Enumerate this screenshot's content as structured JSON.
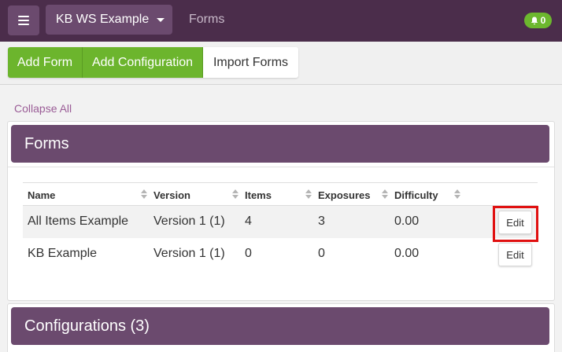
{
  "nav": {
    "workspace_label": "KB WS Example",
    "page_title": "Forms",
    "notification_count": "0"
  },
  "toolbar": {
    "add_form": "Add Form",
    "add_configuration": "Add Configuration",
    "import_forms": "Import Forms"
  },
  "collapse_all": "Collapse All",
  "forms_panel": {
    "title": "Forms",
    "columns": [
      "Name",
      "Version",
      "Items",
      "Exposures",
      "Difficulty"
    ],
    "rows": [
      {
        "name": "All Items Example",
        "version": "Version 1 (1)",
        "items": "4",
        "exposures": "3",
        "difficulty": "0.00",
        "action": "Edit"
      },
      {
        "name": "KB Example",
        "version": "Version 1 (1)",
        "items": "0",
        "exposures": "0",
        "difficulty": "0.00",
        "action": "Edit"
      }
    ]
  },
  "configurations_panel": {
    "title": "Configurations (3)"
  },
  "colors": {
    "nav_bg": "#4b2d4b",
    "panel_header": "#6b4a6e",
    "green": "#6cb52d",
    "link": "#9a5c96",
    "highlight": "#e01010"
  },
  "icons": [
    "menu-icon",
    "caret-down-icon",
    "bell-icon",
    "sort-icon"
  ]
}
